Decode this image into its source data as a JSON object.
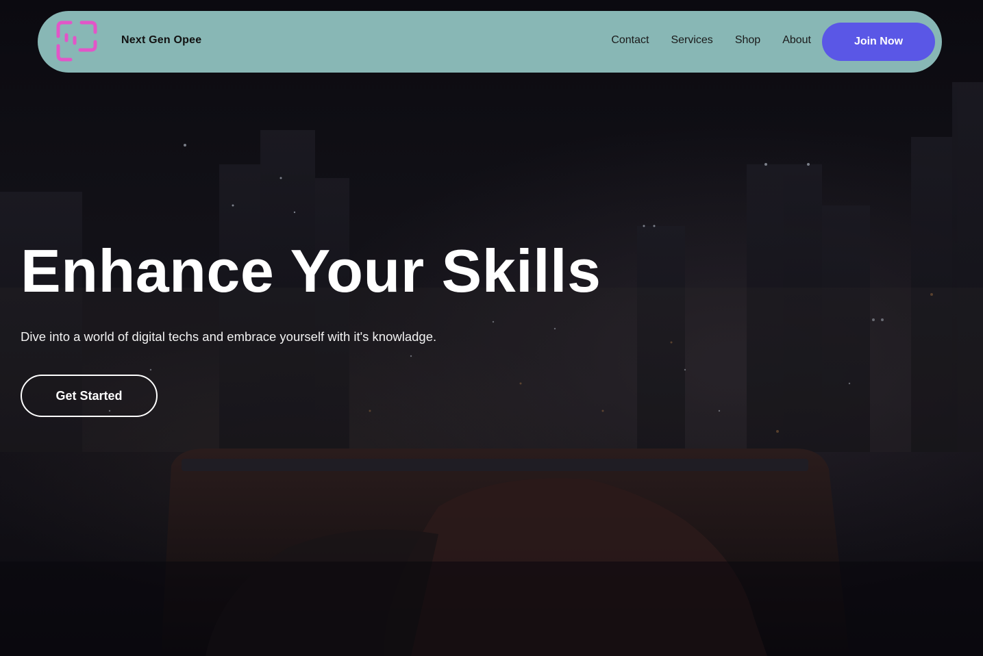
{
  "navbar": {
    "brand": "Next Gen Opee",
    "logo_icon": "frame-corners-icon",
    "links": [
      "Contact",
      "Services",
      "Shop",
      "About"
    ],
    "join_label": "Join Now"
  },
  "hero": {
    "title": "Enhance Your Skills",
    "subtitle": "Dive into a world of digital techs and embrace yourself with it's knowladge.",
    "cta_label": "Get Started",
    "background": "night-city-skyline-image"
  },
  "colors": {
    "navbar_bg": "#88b7b5",
    "accent": "#5a57e6",
    "logo_pink": "#e255c8",
    "hero_text": "#ffffff",
    "page_bg": "#0b0a10"
  }
}
